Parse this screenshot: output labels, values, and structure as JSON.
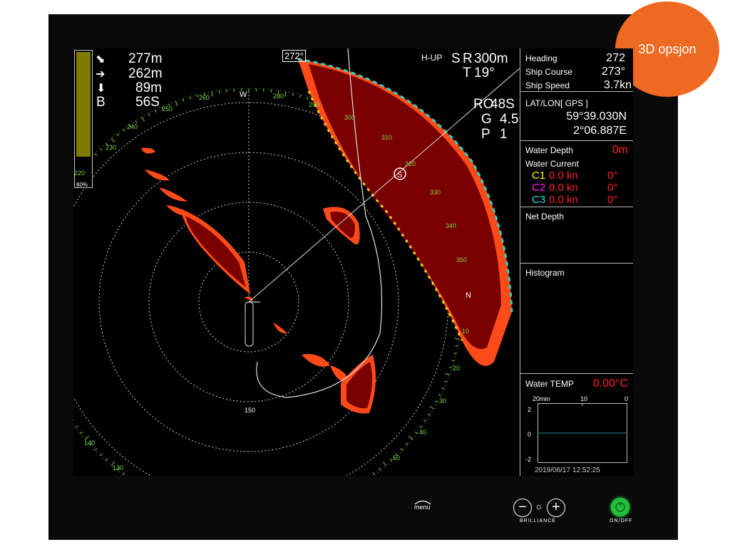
{
  "badge": {
    "label": "3D opsjon"
  },
  "gain": {
    "percent_label": "80%",
    "left_scale": "220"
  },
  "ranges": {
    "slant": "277m",
    "horizontal": "262m",
    "depth": "89m",
    "bearing_label": "B",
    "bearing_value": "56S"
  },
  "top_center": {
    "heading_marker": "272°"
  },
  "mode": {
    "orientation": "H-UP",
    "mode_letter": "S",
    "range_letter": "R",
    "range_value": "300m",
    "tilt_letter": "T",
    "tilt_value": "19°",
    "ro_label": "RO",
    "ro_value": "48S",
    "g_label": "G",
    "g_value": "4.5",
    "p_label": "P",
    "p_value": "1"
  },
  "compass": {
    "west": "W",
    "north": "N",
    "labels": [
      "230",
      "240",
      "250",
      "260",
      "280",
      "290",
      "300",
      "310",
      "320",
      "330",
      "340",
      "350",
      "10",
      "20",
      "30",
      "40",
      "50",
      "150",
      "140",
      "130"
    ]
  },
  "info": {
    "heading_label": "Heading",
    "heading_value": "272",
    "course_label": "Ship Course",
    "course_value": "273°",
    "speed_label": "Ship Speed",
    "speed_value": "3.7kn",
    "latlon_label": "LAT/LON[ GPS ]",
    "lat": "59°39.030N",
    "lon": "2°06.887E",
    "depth_label": "Water Depth",
    "depth_value": "0m",
    "current_label": "Water Current",
    "currents": [
      {
        "name": "C1",
        "speed": "0.0 kn",
        "dir": "0°",
        "color": "#ffff00"
      },
      {
        "name": "C2",
        "speed": "0.0 kn",
        "dir": "0°",
        "color": "#ff20ff"
      },
      {
        "name": "C3",
        "speed": "0.0 kn",
        "dir": "0°",
        "color": "#20e0e0"
      }
    ],
    "net_depth_label": "Net Depth",
    "histogram_label": "Histogram",
    "temp_label": "Water TEMP",
    "temp_value": "0.00°C",
    "graph_top": [
      "20min",
      "10",
      "0"
    ],
    "graph_y": [
      "2",
      "0",
      "-2"
    ],
    "datetime": "2019/06/17 12:52:25"
  },
  "controls": {
    "menu_label": "menu",
    "brilliance_label": "BRILLIANCE",
    "onoff_label": "ON/OFF",
    "minus_glyph": "−",
    "plus_glyph": "+",
    "sun_glyph": "☼"
  },
  "colors": {
    "accent": "#ee6a22",
    "echo": "#7a0000",
    "scale": "#7fd84a",
    "power": "#22c03a"
  }
}
